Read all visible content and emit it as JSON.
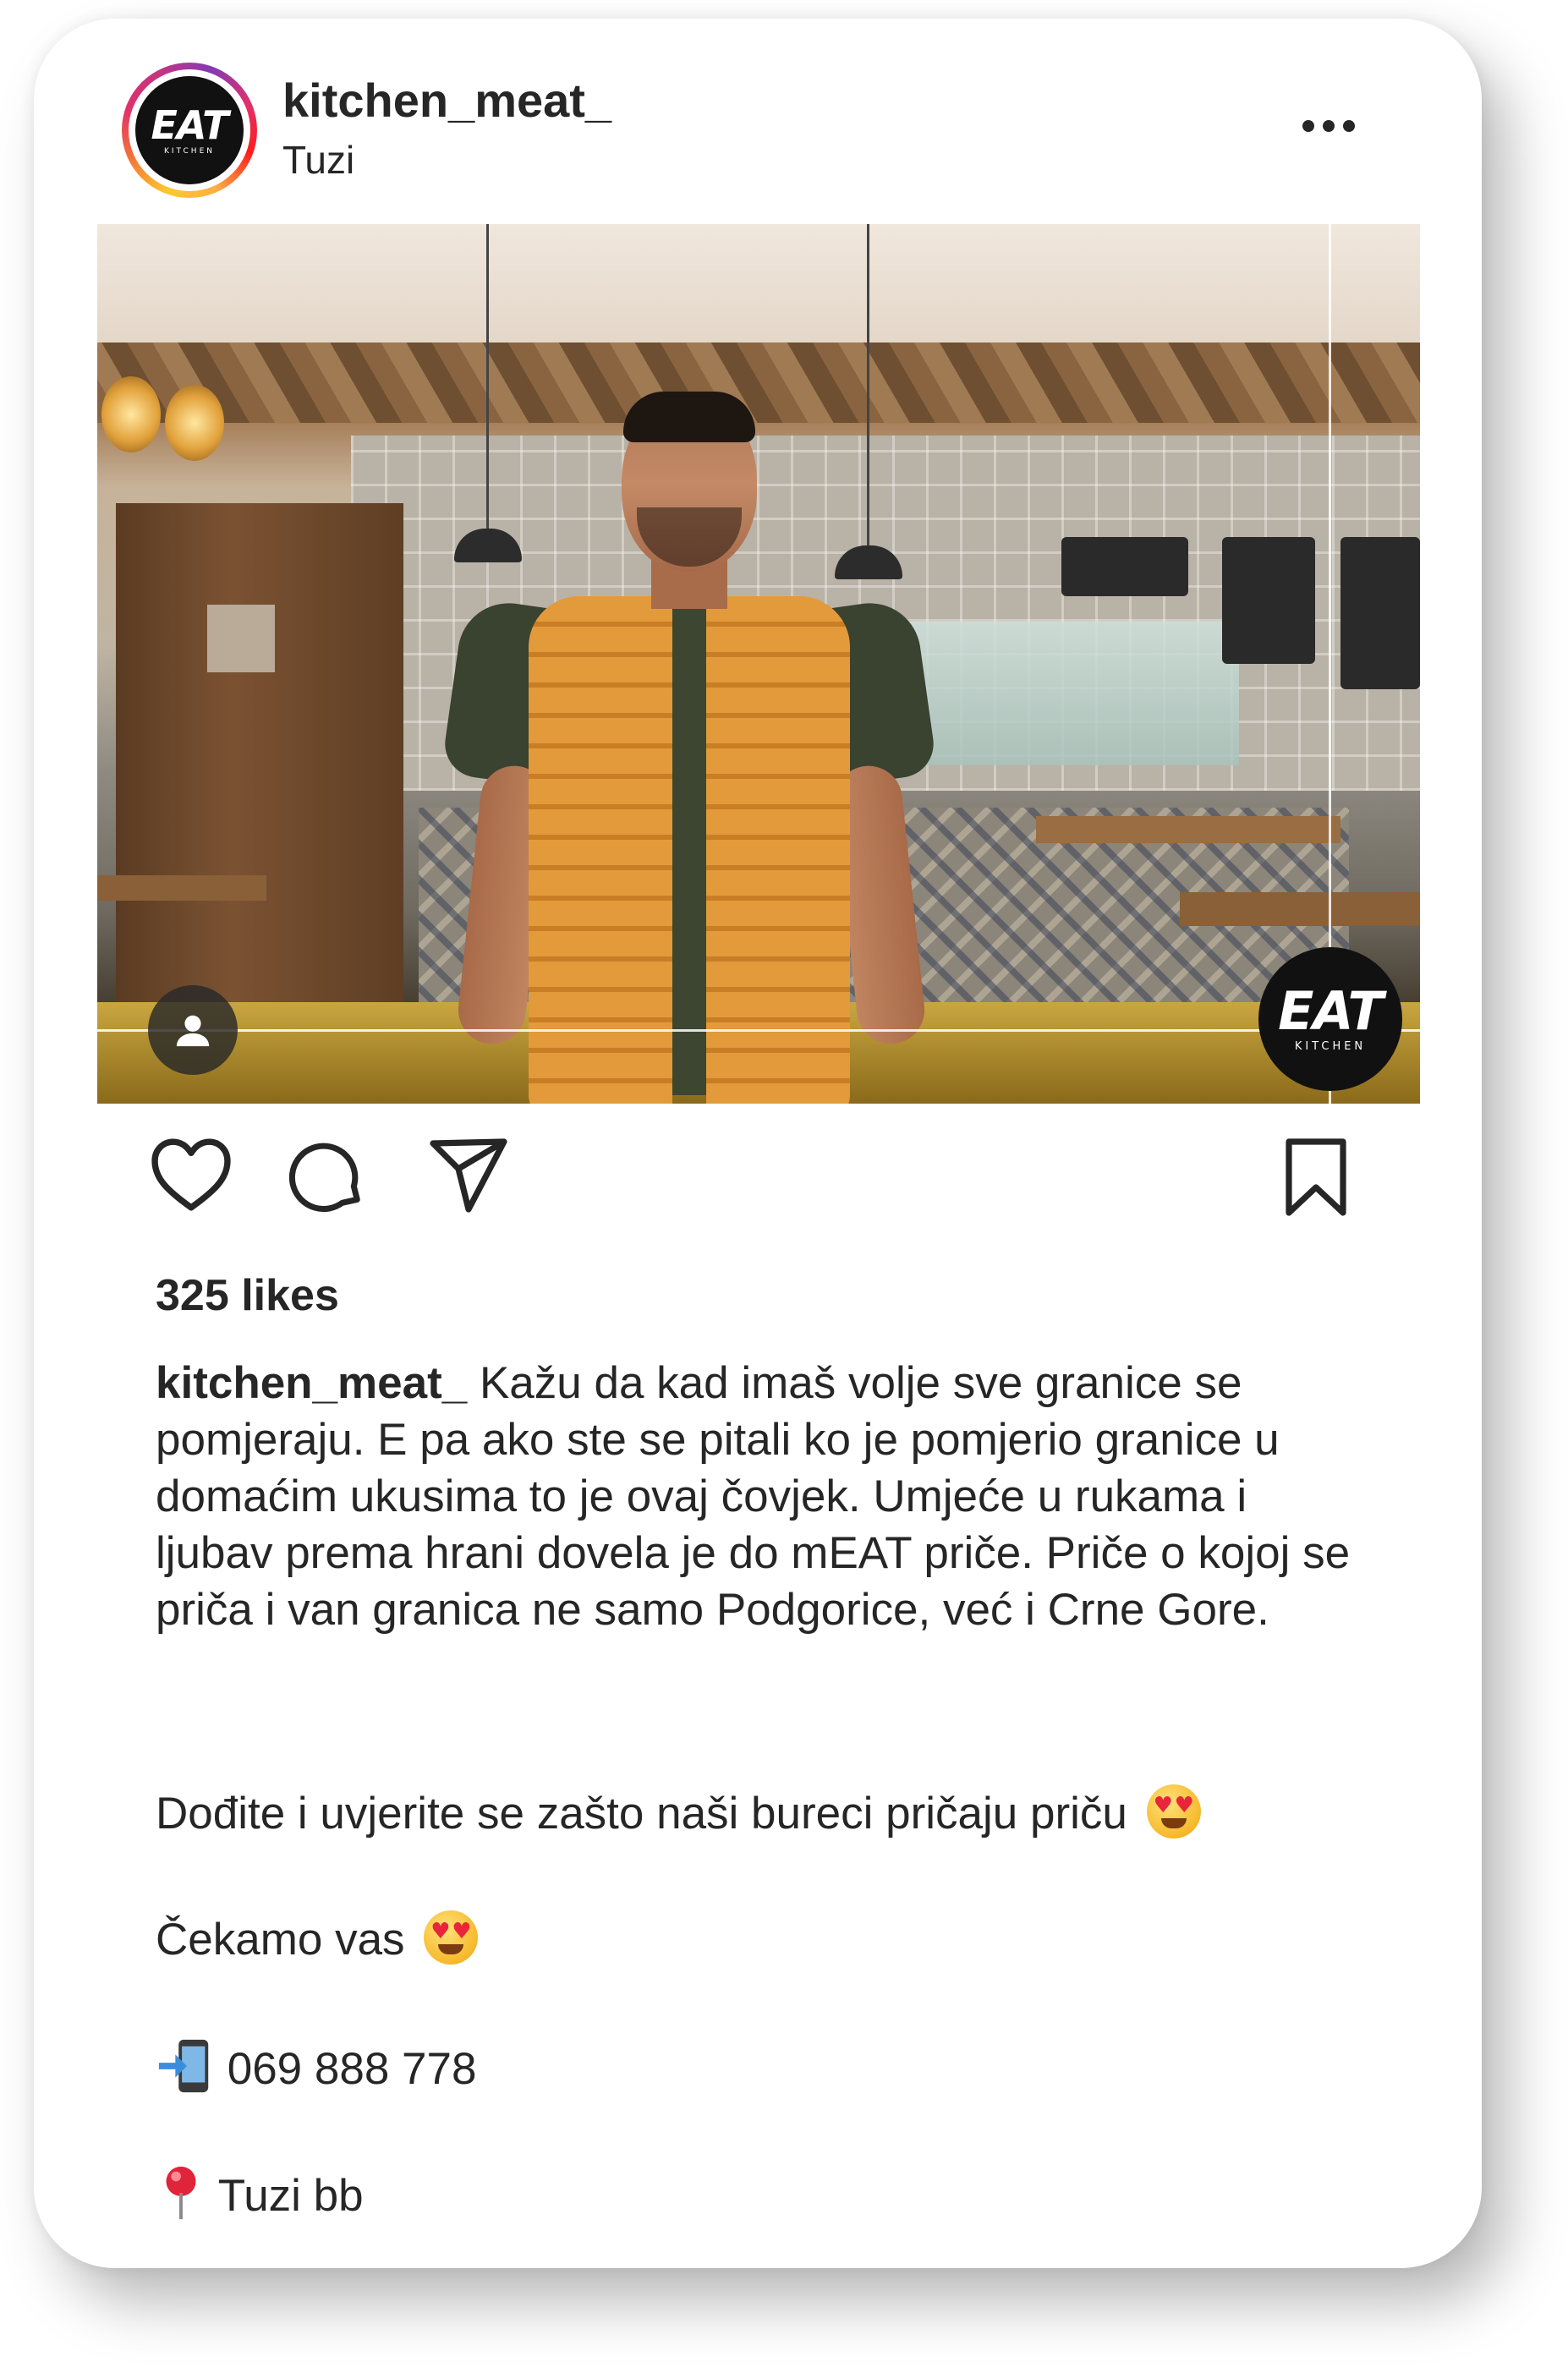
{
  "post": {
    "username": "kitchen_meat_",
    "location": "Tuzi",
    "avatar_logo_main": "EAT",
    "avatar_logo_sub": "KITCHEN",
    "photo_logo_main": "EAT",
    "photo_logo_sub": "KITCHEN"
  },
  "actions": {
    "like_icon": "heart-icon",
    "comment_icon": "comment-icon",
    "share_icon": "send-icon",
    "save_icon": "bookmark-icon"
  },
  "likes_text": "325 likes",
  "caption": {
    "username": "kitchen_meat_",
    "text": " Kažu da kad imaš volje sve granice se pomjeraju. E pa ako ste se pitali ko je pomjerio granice u domaćim ukusima to je ovaj čovjek. Umjeće u rukama i ljubav prema hrani dovela je do mEAT priče. Priče o kojoj se priča i van granica ne samo Podgorice, već i Crne Gore.",
    "line2": "Dođite i uvjerite se zašto naši bureci pričaju priču",
    "line3": "Čekamo vas",
    "phone": "069 888 778",
    "address": "Tuzi bb"
  },
  "colors": {
    "text": "#262626",
    "vest": "#e39a3a",
    "ring_start": "#fdc830",
    "ring_end": "#c13584"
  }
}
